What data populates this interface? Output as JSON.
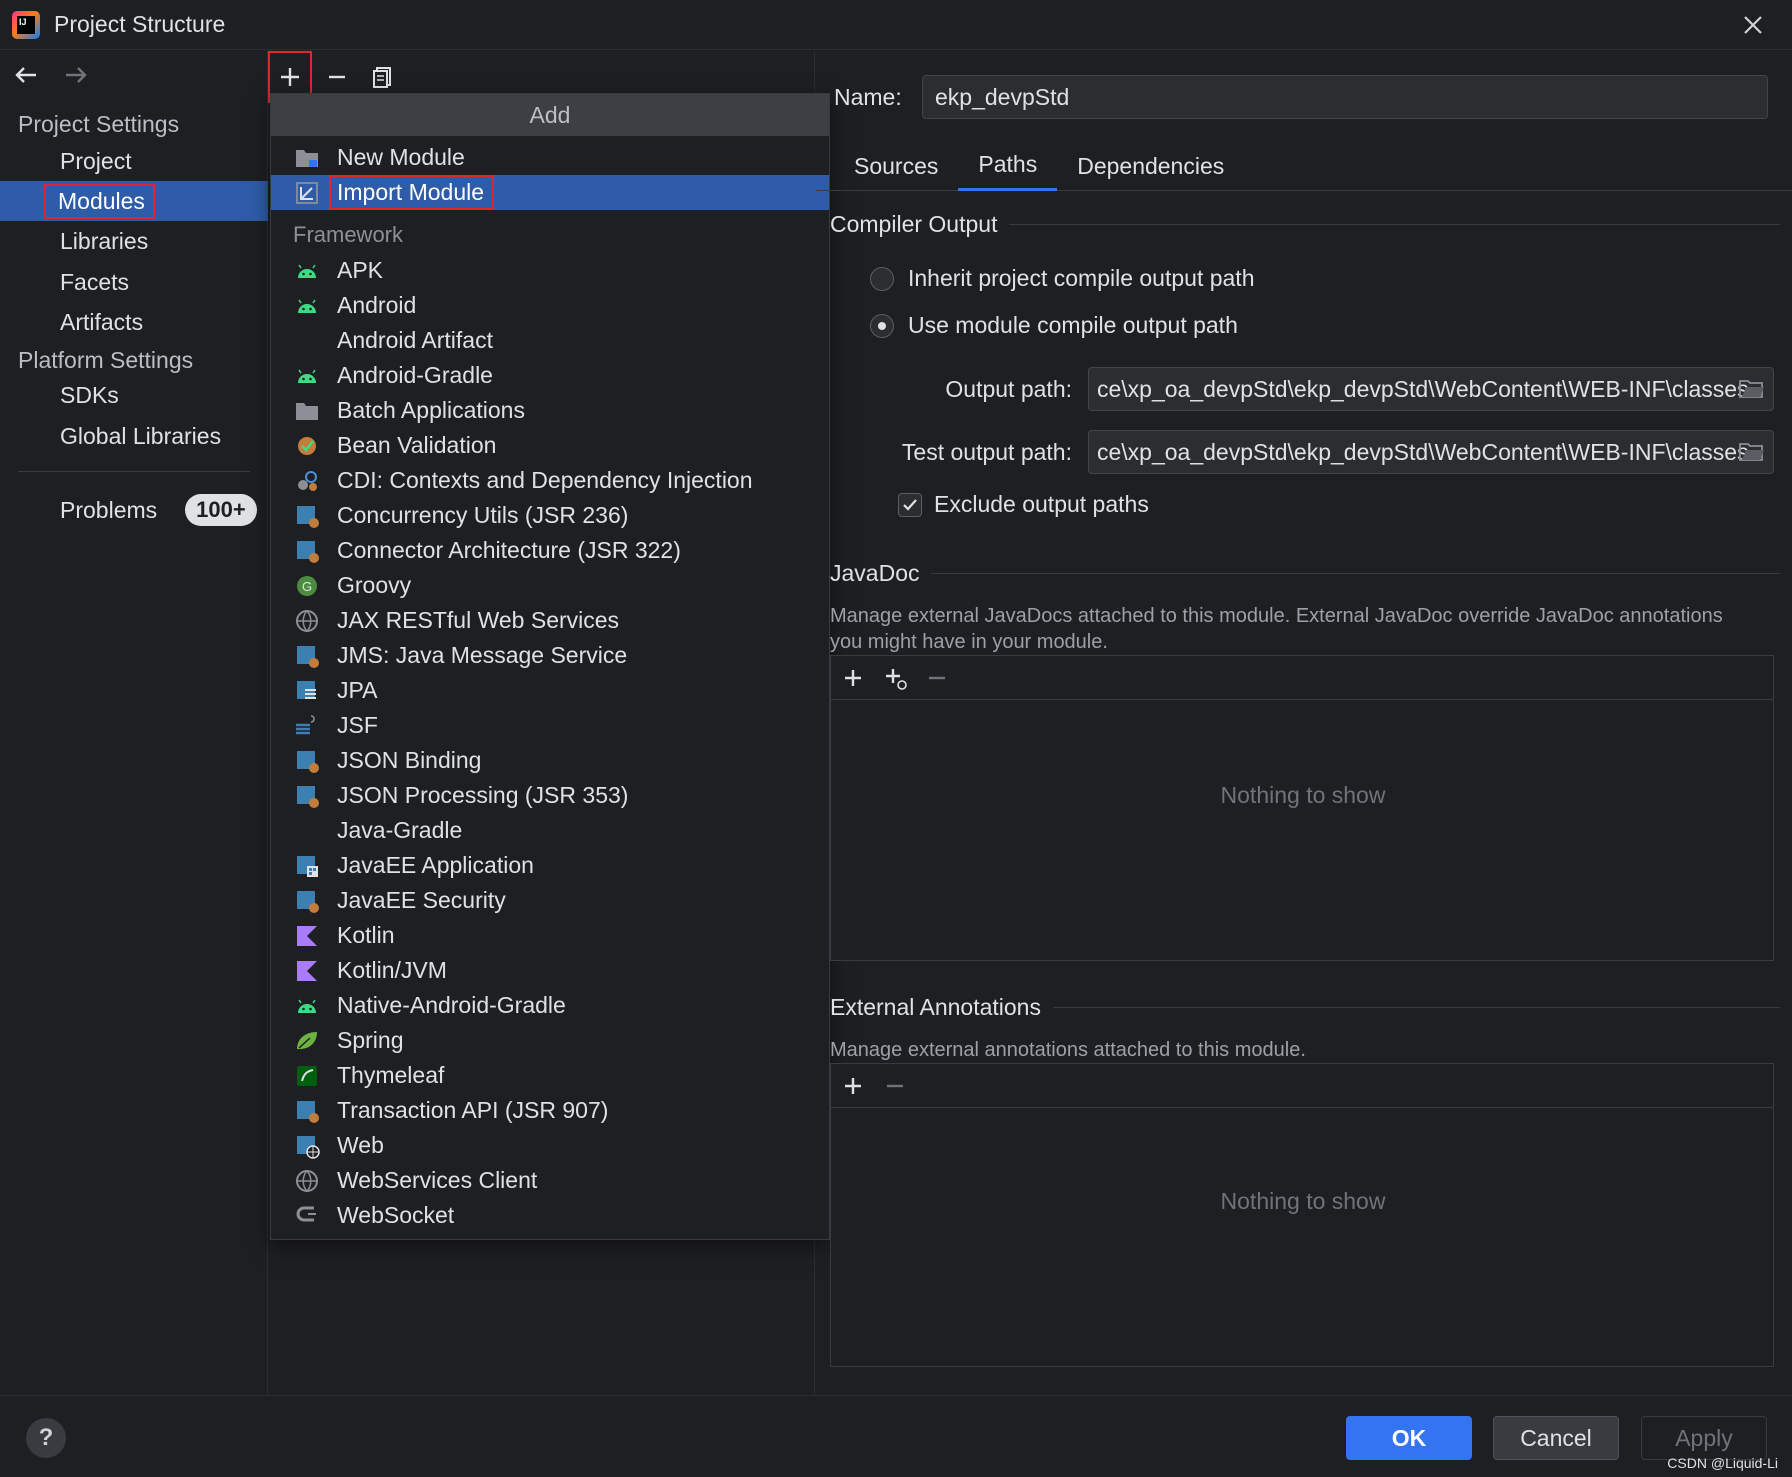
{
  "window": {
    "title": "Project Structure"
  },
  "sidebar": {
    "project_settings_header": "Project Settings",
    "platform_settings_header": "Platform Settings",
    "items": [
      {
        "label": "Project"
      },
      {
        "label": "Modules",
        "selected": true
      },
      {
        "label": "Libraries"
      },
      {
        "label": "Facets"
      },
      {
        "label": "Artifacts"
      }
    ],
    "platform_items": [
      {
        "label": "SDKs"
      },
      {
        "label": "Global Libraries"
      }
    ],
    "problems": {
      "label": "Problems",
      "count": "100+"
    }
  },
  "popup": {
    "header": "Add",
    "items": [
      {
        "label": "New Module",
        "icon": "folder-module-icon"
      },
      {
        "label": "Import Module",
        "icon": "import-module-icon",
        "selected": true
      }
    ],
    "framework_header": "Framework",
    "frameworks": [
      {
        "label": "APK",
        "icon": "android-icon"
      },
      {
        "label": "Android",
        "icon": "android-icon"
      },
      {
        "label": "Android Artifact",
        "icon": ""
      },
      {
        "label": "Android-Gradle",
        "icon": "android-icon"
      },
      {
        "label": "Batch Applications",
        "icon": "folder-icon"
      },
      {
        "label": "Bean Validation",
        "icon": "bean-validation-icon"
      },
      {
        "label": "CDI: Contexts and Dependency Injection",
        "icon": "cdi-icon"
      },
      {
        "label": "Concurrency Utils (JSR 236)",
        "icon": "javaee-icon"
      },
      {
        "label": "Connector Architecture (JSR 322)",
        "icon": "javaee-icon"
      },
      {
        "label": "Groovy",
        "icon": "groovy-icon"
      },
      {
        "label": "JAX RESTful Web Services",
        "icon": "globe-icon"
      },
      {
        "label": "JMS: Java Message Service",
        "icon": "javaee-icon"
      },
      {
        "label": "JPA",
        "icon": "jpa-icon"
      },
      {
        "label": "JSF",
        "icon": "jsf-icon"
      },
      {
        "label": "JSON Binding",
        "icon": "javaee-icon"
      },
      {
        "label": "JSON Processing (JSR 353)",
        "icon": "javaee-icon"
      },
      {
        "label": "Java-Gradle",
        "icon": ""
      },
      {
        "label": "JavaEE Application",
        "icon": "javaee-app-icon"
      },
      {
        "label": "JavaEE Security",
        "icon": "javaee-icon"
      },
      {
        "label": "Kotlin",
        "icon": "kotlin-icon"
      },
      {
        "label": "Kotlin/JVM",
        "icon": "kotlin-icon"
      },
      {
        "label": "Native-Android-Gradle",
        "icon": "android-icon"
      },
      {
        "label": "Spring",
        "icon": "spring-icon"
      },
      {
        "label": "Thymeleaf",
        "icon": "thymeleaf-icon"
      },
      {
        "label": "Transaction API (JSR 907)",
        "icon": "javaee-icon"
      },
      {
        "label": "Web",
        "icon": "web-icon"
      },
      {
        "label": "WebServices Client",
        "icon": "globe-icon"
      },
      {
        "label": "WebSocket",
        "icon": "websocket-icon"
      }
    ]
  },
  "module": {
    "name_label": "Name:",
    "name_value": "ekp_devpStd",
    "tabs": [
      {
        "label": "Sources"
      },
      {
        "label": "Paths",
        "active": true
      },
      {
        "label": "Dependencies"
      }
    ],
    "compiler_output": {
      "title": "Compiler Output",
      "inherit_label": "Inherit project compile output path",
      "use_module_label": "Use module compile output path",
      "selected": "use_module",
      "output_path_label": "Output path:",
      "output_path_value": "ce\\xp_oa_devpStd\\ekp_devpStd\\WebContent\\WEB-INF\\classes",
      "test_output_path_label": "Test output path:",
      "test_output_path_value": "ce\\xp_oa_devpStd\\ekp_devpStd\\WebContent\\WEB-INF\\classes",
      "exclude_label": "Exclude output paths",
      "exclude_checked": true
    },
    "javadoc": {
      "title": "JavaDoc",
      "description": "Manage external JavaDocs attached to this module. External JavaDoc override JavaDoc annotations you might have in your module.",
      "empty_text": "Nothing to show"
    },
    "external_annotations": {
      "title": "External Annotations",
      "description": "Manage external annotations attached to this module.",
      "empty_text": "Nothing to show"
    }
  },
  "buttons": {
    "ok": "OK",
    "cancel": "Cancel",
    "apply": "Apply",
    "help": "?"
  },
  "watermark": "CSDN @Liquid-Li",
  "colors": {
    "accent": "#3574f0",
    "selection": "#2e5ca8",
    "highlight_box": "#e0252f",
    "background": "#1e1f22"
  }
}
